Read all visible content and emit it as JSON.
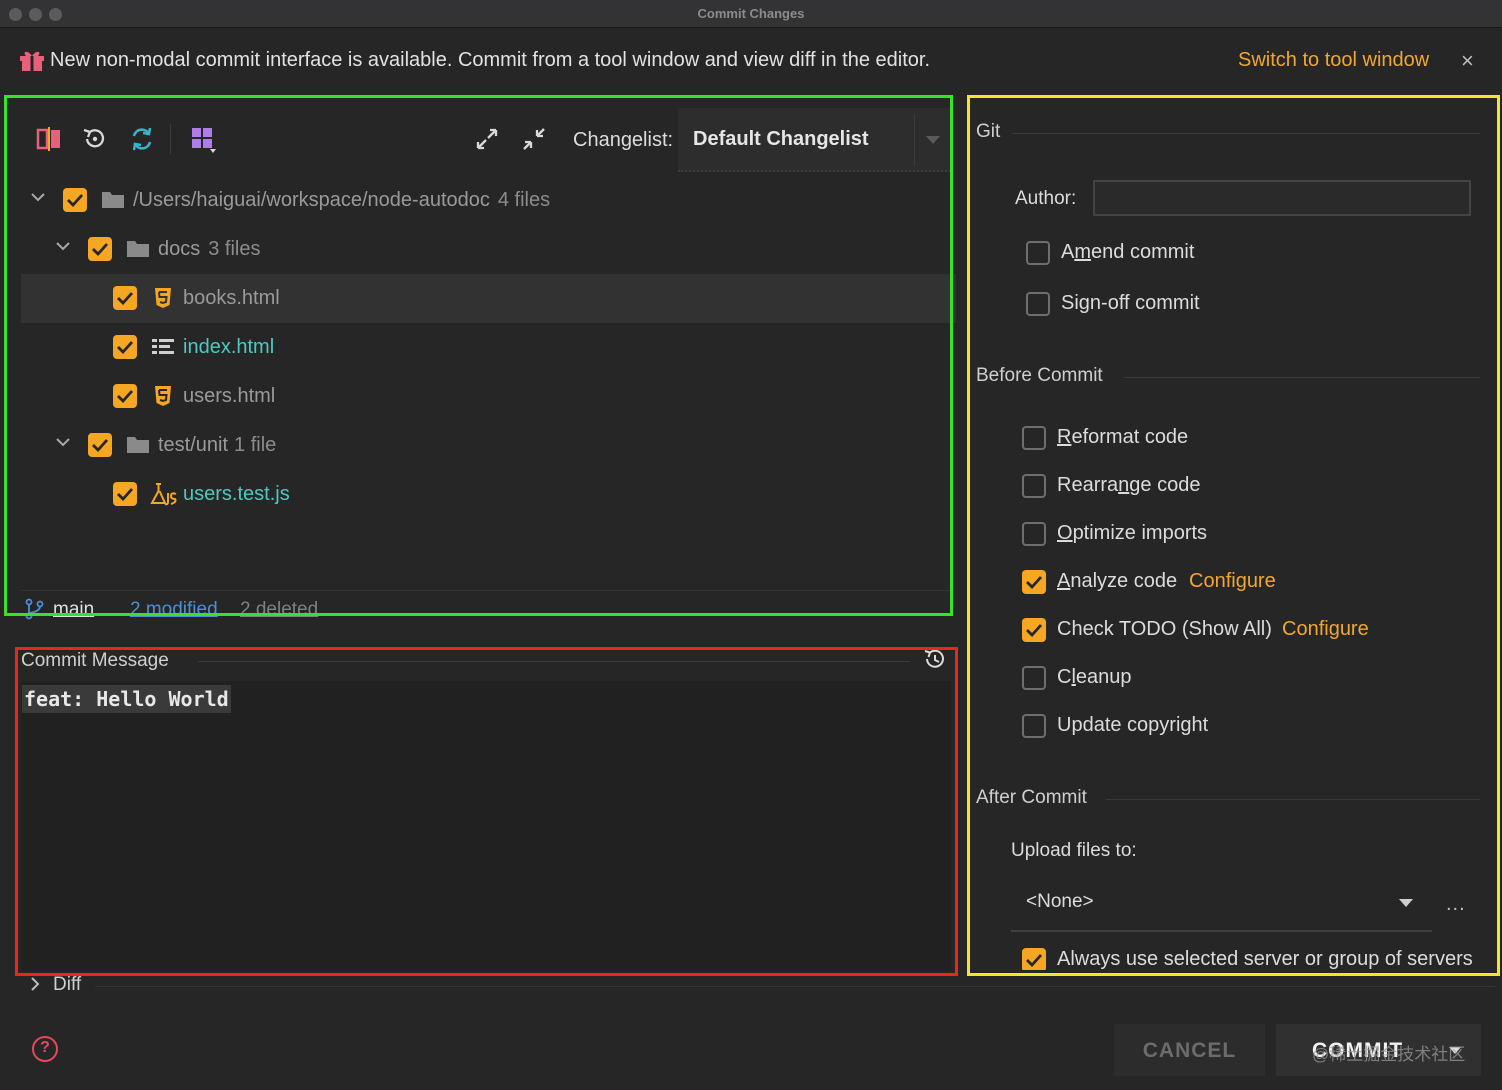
{
  "window": {
    "title": "Commit Changes"
  },
  "banner": {
    "message": "New non-modal commit interface is available. Commit from a tool window and view diff in the editor.",
    "switch_link": "Switch to tool window",
    "close_glyph": "×"
  },
  "changelist": {
    "label": "Changelist:",
    "selected": "Default Changelist"
  },
  "tree": {
    "root": {
      "name": "/Users/haiguai/workspace/node-autodoc",
      "count": "4 files"
    },
    "docs": {
      "name": "docs",
      "count": "3 files"
    },
    "files": [
      {
        "name": "books.html",
        "icon": "html5-icon"
      },
      {
        "name": "index.html",
        "icon": "list-file-icon"
      },
      {
        "name": "users.html",
        "icon": "html5-icon"
      }
    ],
    "test": {
      "name": "test/unit",
      "count": "1 file"
    },
    "test_file": {
      "name": "users.test.js",
      "icon": "js-test-icon"
    }
  },
  "status": {
    "branch": "main",
    "modified": "2 modified",
    "deleted": "2 deleted"
  },
  "commit_message": {
    "label": "Commit Message",
    "text": "feat: Hello World"
  },
  "diff": {
    "label": "Diff"
  },
  "git": {
    "title": "Git",
    "author_label": "Author:",
    "author_value": "",
    "amend_pre": "A",
    "amend_u": "m",
    "amend_post": "end commit",
    "signoff": "Sign-off commit"
  },
  "before_commit": {
    "title": "Before Commit",
    "reformat_u": "R",
    "reformat_post": "eformat code",
    "rearrange_pre": "Rearra",
    "rearrange_u": "n",
    "rearrange_post": "ge code",
    "optimize_u": "O",
    "optimize_post": "ptimize imports",
    "analyze_u": "A",
    "analyze_post": "nalyze code",
    "check_todo": "Check TODO (Show All)",
    "cleanup_pre": "C",
    "cleanup_u": "l",
    "cleanup_post": "eanup",
    "update_copyright": "Update copyright",
    "configure": "Configure"
  },
  "after_commit": {
    "title": "After Commit",
    "upload_label": "Upload files to:",
    "upload_value": "<None>",
    "more": "...",
    "always_use": "Always use selected server or group of servers"
  },
  "buttons": {
    "cancel": "CANCEL",
    "commit": "COMMIT",
    "help": "?"
  },
  "watermark": "@稀土掘金技术社区",
  "colors": {
    "accent": "#f5a623",
    "link": "#f0a732",
    "teal": "#4ec9c0",
    "blue": "#4a90d9"
  }
}
